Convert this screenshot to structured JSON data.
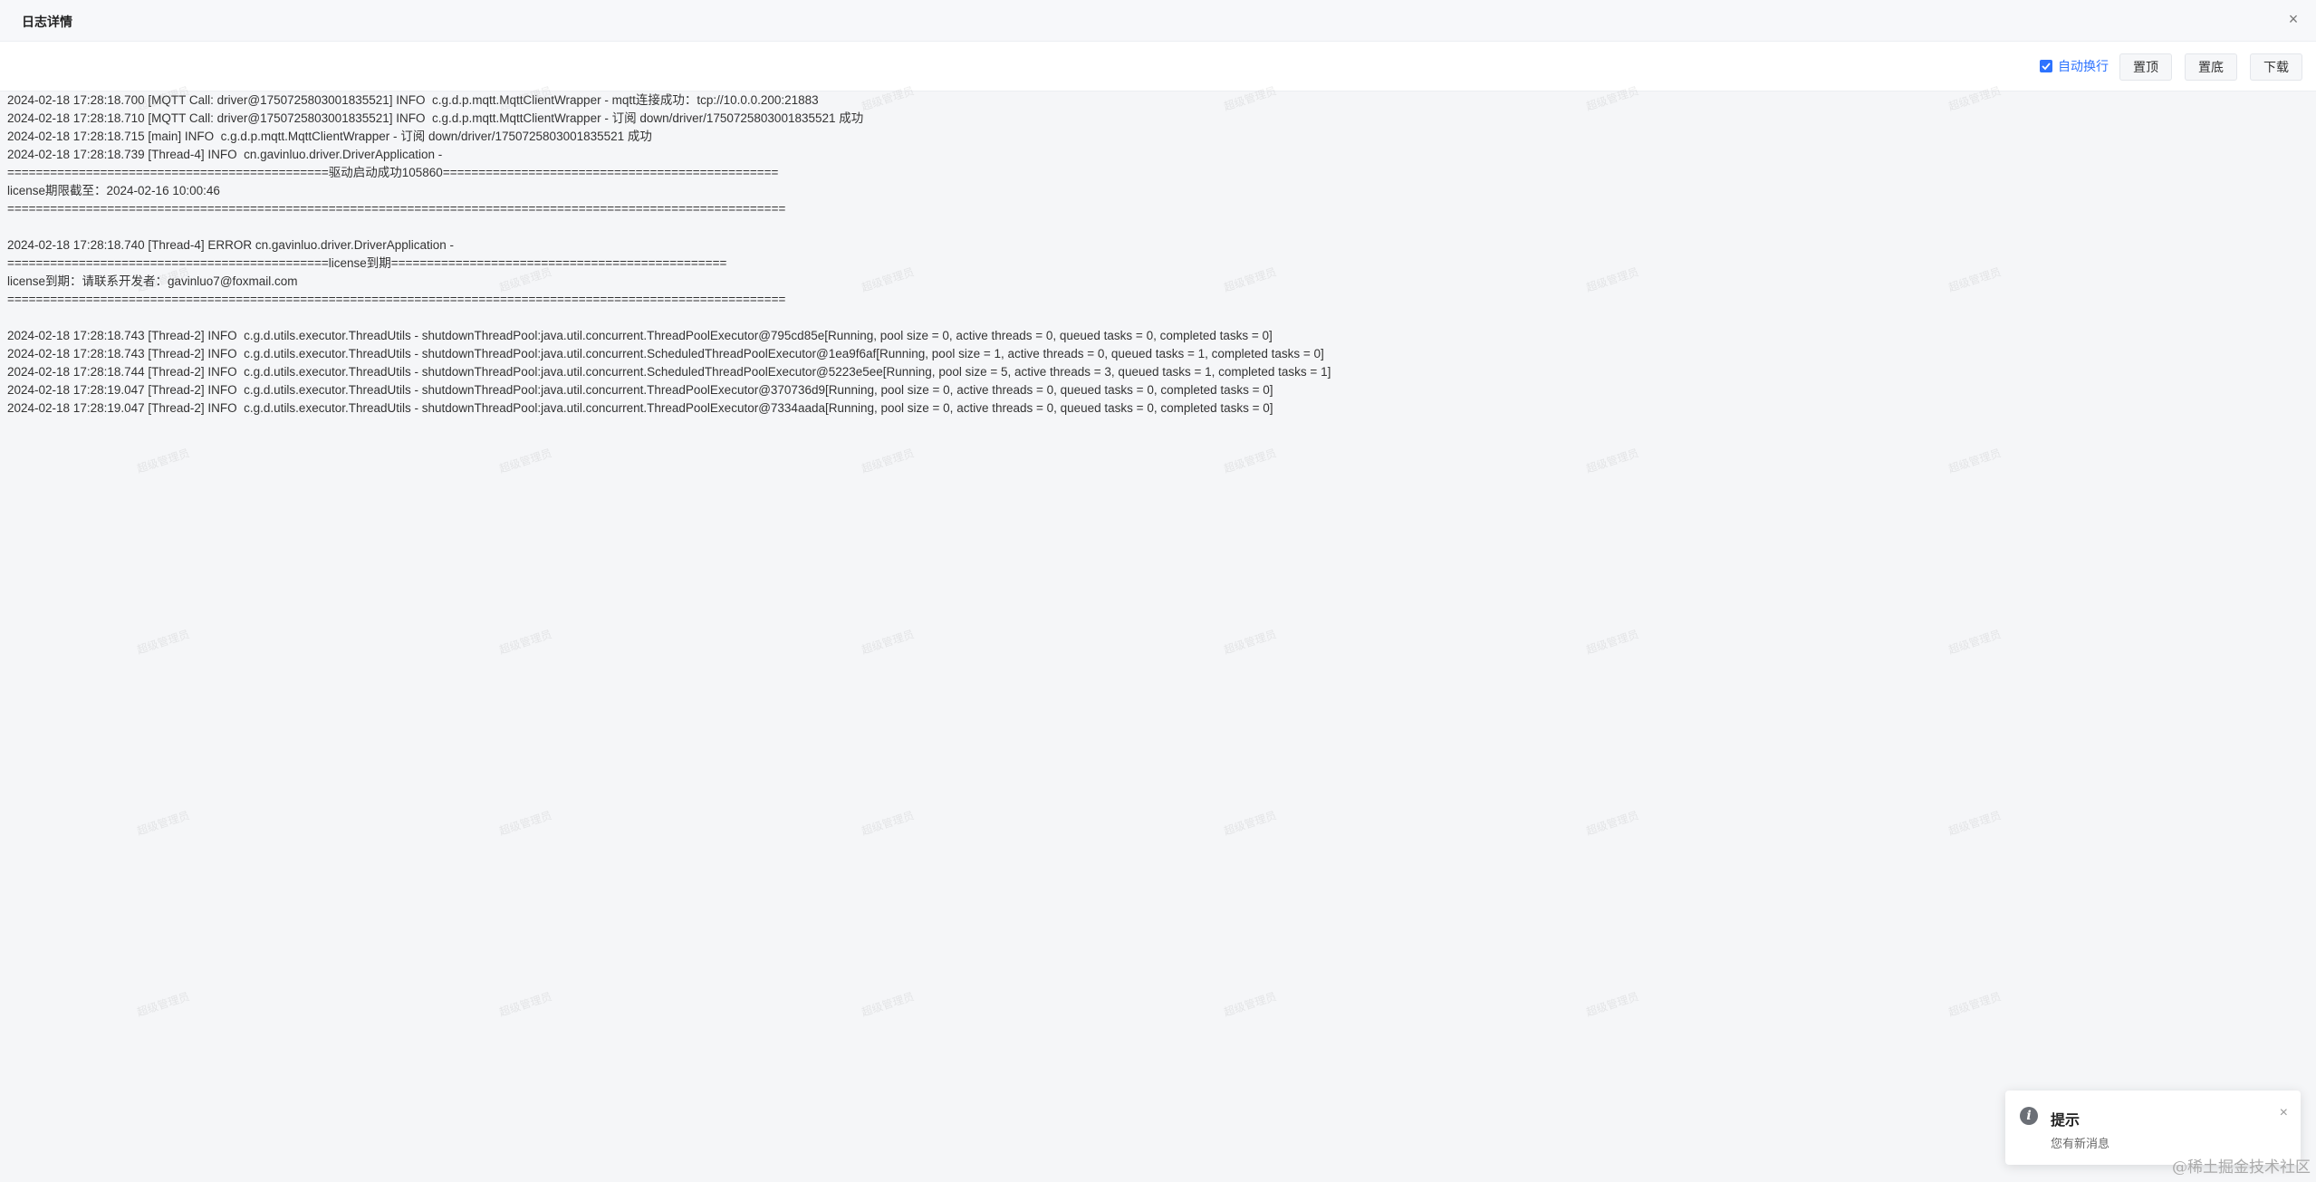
{
  "header": {
    "title": "日志详情",
    "close_icon": "close-icon"
  },
  "toolbar": {
    "wrap_label": "自动换行",
    "wrap_checked": true,
    "top_label": "置顶",
    "bottom_label": "置底",
    "download_label": "下载"
  },
  "log": {
    "lines": [
      "2024-02-18 17:28:18.700 [MQTT Call: driver@1750725803001835521] INFO  c.g.d.p.mqtt.MqttClientWrapper - mqtt连接成功：tcp://10.0.0.200:21883",
      "2024-02-18 17:28:18.710 [MQTT Call: driver@1750725803001835521] INFO  c.g.d.p.mqtt.MqttClientWrapper - 订阅 down/driver/1750725803001835521 成功",
      "2024-02-18 17:28:18.715 [main] INFO  c.g.d.p.mqtt.MqttClientWrapper - 订阅 down/driver/1750725803001835521 成功",
      "2024-02-18 17:28:18.739 [Thread-4] INFO  cn.gavinluo.driver.DriverApplication -",
      "=============================================驱动启动成功105860===============================================",
      "license期限截至：2024-02-16 10:00:46",
      "=============================================================================================================",
      "",
      "2024-02-18 17:28:18.740 [Thread-4] ERROR cn.gavinluo.driver.DriverApplication -",
      "=============================================license到期===============================================",
      "license到期：请联系开发者：gavinluo7@foxmail.com",
      "=============================================================================================================",
      "",
      "2024-02-18 17:28:18.743 [Thread-2] INFO  c.g.d.utils.executor.ThreadUtils - shutdownThreadPool:java.util.concurrent.ThreadPoolExecutor@795cd85e[Running, pool size = 0, active threads = 0, queued tasks = 0, completed tasks = 0]",
      "2024-02-18 17:28:18.743 [Thread-2] INFO  c.g.d.utils.executor.ThreadUtils - shutdownThreadPool:java.util.concurrent.ScheduledThreadPoolExecutor@1ea9f6af[Running, pool size = 1, active threads = 0, queued tasks = 1, completed tasks = 0]",
      "2024-02-18 17:28:18.744 [Thread-2] INFO  c.g.d.utils.executor.ThreadUtils - shutdownThreadPool:java.util.concurrent.ScheduledThreadPoolExecutor@5223e5ee[Running, pool size = 5, active threads = 3, queued tasks = 1, completed tasks = 1]",
      "2024-02-18 17:28:19.047 [Thread-2] INFO  c.g.d.utils.executor.ThreadUtils - shutdownThreadPool:java.util.concurrent.ThreadPoolExecutor@370736d9[Running, pool size = 0, active threads = 0, queued tasks = 0, completed tasks = 0]",
      "2024-02-18 17:28:19.047 [Thread-2] INFO  c.g.d.utils.executor.ThreadUtils - shutdownThreadPool:java.util.concurrent.ThreadPoolExecutor@7334aada[Running, pool size = 0, active threads = 0, queued tasks = 0, completed tasks = 0]"
    ]
  },
  "watermark": {
    "text": "超级管理员"
  },
  "notification": {
    "title": "提示",
    "message": "您有新消息",
    "icon": "info-icon"
  },
  "footer": {
    "text": "@稀土掘金技术社区"
  },
  "colors": {
    "accent": "#2d73ff",
    "background": "#f5f6f8"
  }
}
